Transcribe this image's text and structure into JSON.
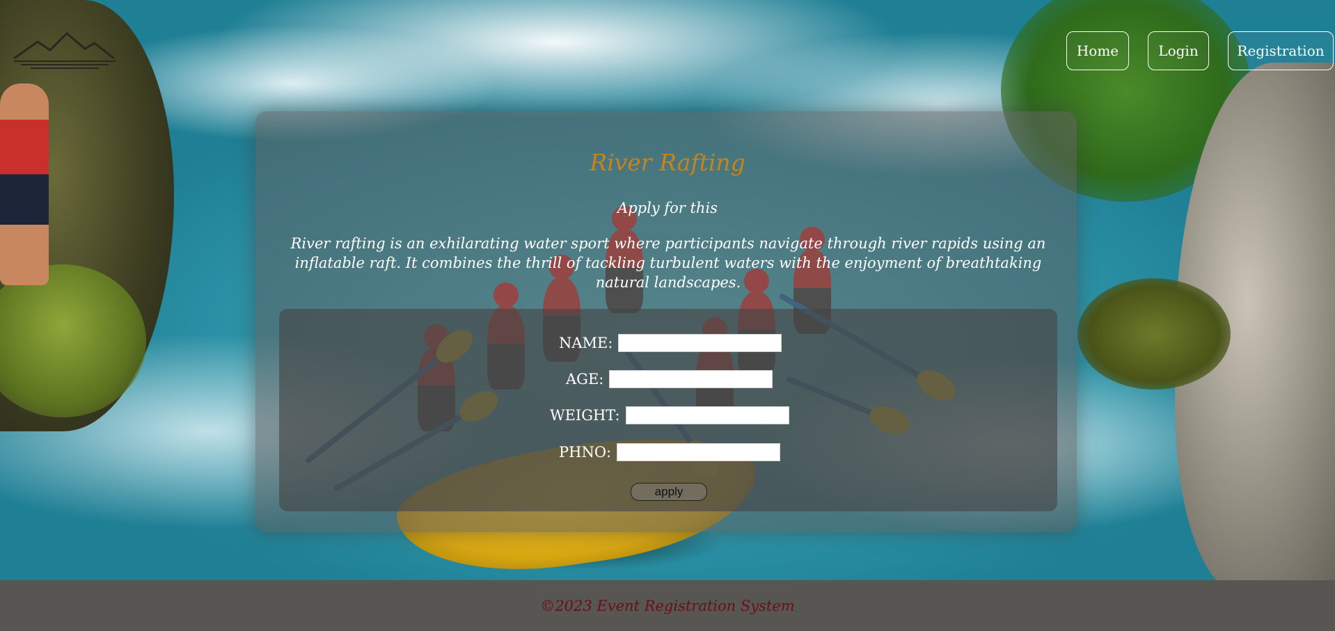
{
  "nav": {
    "items": [
      {
        "label": "Home"
      },
      {
        "label": "Login"
      },
      {
        "label": "Registration"
      }
    ]
  },
  "panel": {
    "title": "River Rafting",
    "subtitle": "Apply for this",
    "description": "River rafting is an exhilarating water sport where participants navigate through river rapids using an inflatable raft. It combines the thrill of tackling turbulent waters with the enjoyment of breathtaking natural landscapes."
  },
  "form": {
    "fields": [
      {
        "label": "NAME:",
        "value": ""
      },
      {
        "label": "AGE:",
        "value": ""
      },
      {
        "label": "WEIGHT:",
        "value": ""
      },
      {
        "label": "PHNO:",
        "value": ""
      }
    ],
    "submit_label": "apply"
  },
  "footer": {
    "text": "©2023 Event Registration System"
  },
  "colors": {
    "title": "#c8841c",
    "footer_bg": "#585652",
    "footer_text": "#6a0f18"
  },
  "icons": {
    "logo": "mountain-logo-icon"
  }
}
